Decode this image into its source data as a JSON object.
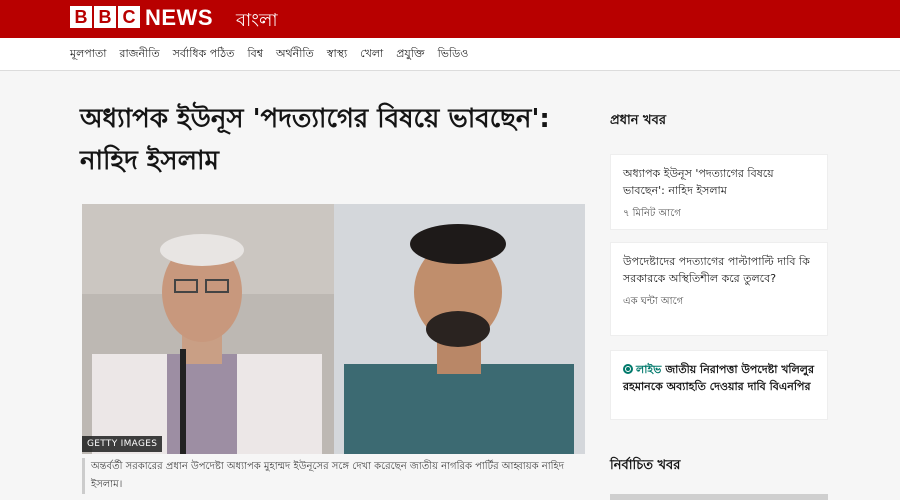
{
  "brand": {
    "letters": [
      "B",
      "B",
      "C"
    ],
    "news": "NEWS",
    "language": "বাংলা",
    "color": "#b80000"
  },
  "nav": {
    "items": [
      "মূলপাতা",
      "রাজনীতি",
      "সর্বাধিক পঠিত",
      "বিশ্ব",
      "অর্থনীতি",
      "স্বাস্থ্য",
      "খেলা",
      "প্রযুক্তি",
      "ভিডিও"
    ]
  },
  "article": {
    "headline": "অধ্যাপক ইউনূস 'পদত্যাগের বিষয়ে ভাবছেন': নাহিদ ইসলাম",
    "image_credit": "GETTY IMAGES",
    "caption": "অন্তর্বর্তী সরকারের প্রধান উপদেষ্টা অধ্যাপক মুহাম্মদ ইউনূসের সঙ্গে দেখা করেছেন জাতীয় নাগরিক পার্টির আহ্বায়ক নাহিদ ইসলাম।"
  },
  "sidebar": {
    "top_news_title": "প্রধান খবর",
    "cards": [
      {
        "title": "অধ্যাপক ইউনূস 'পদত্যাগের বিষয়ে ভাবছেন': নাহিদ ইসলাম",
        "time": "৭ মিনিট আগে"
      },
      {
        "title": "উপদেষ্টাদের পদত্যাগের পাল্টাপাল্টি দাবি কি সরকারকে অস্থিতিশীল করে তুলবে?",
        "time": "এক ঘন্টা আগে"
      },
      {
        "live_label": "লাইভ",
        "title": "জাতীয় নিরাপত্তা উপদেষ্টা খলিলুর রহমানকে অব্যাহতি দেওয়ার দাবি বিএনপির"
      }
    ],
    "selected_title": "নির্বাচিত খবর"
  },
  "colors": {
    "brand_red": "#b80000",
    "live_green": "#00796b"
  }
}
